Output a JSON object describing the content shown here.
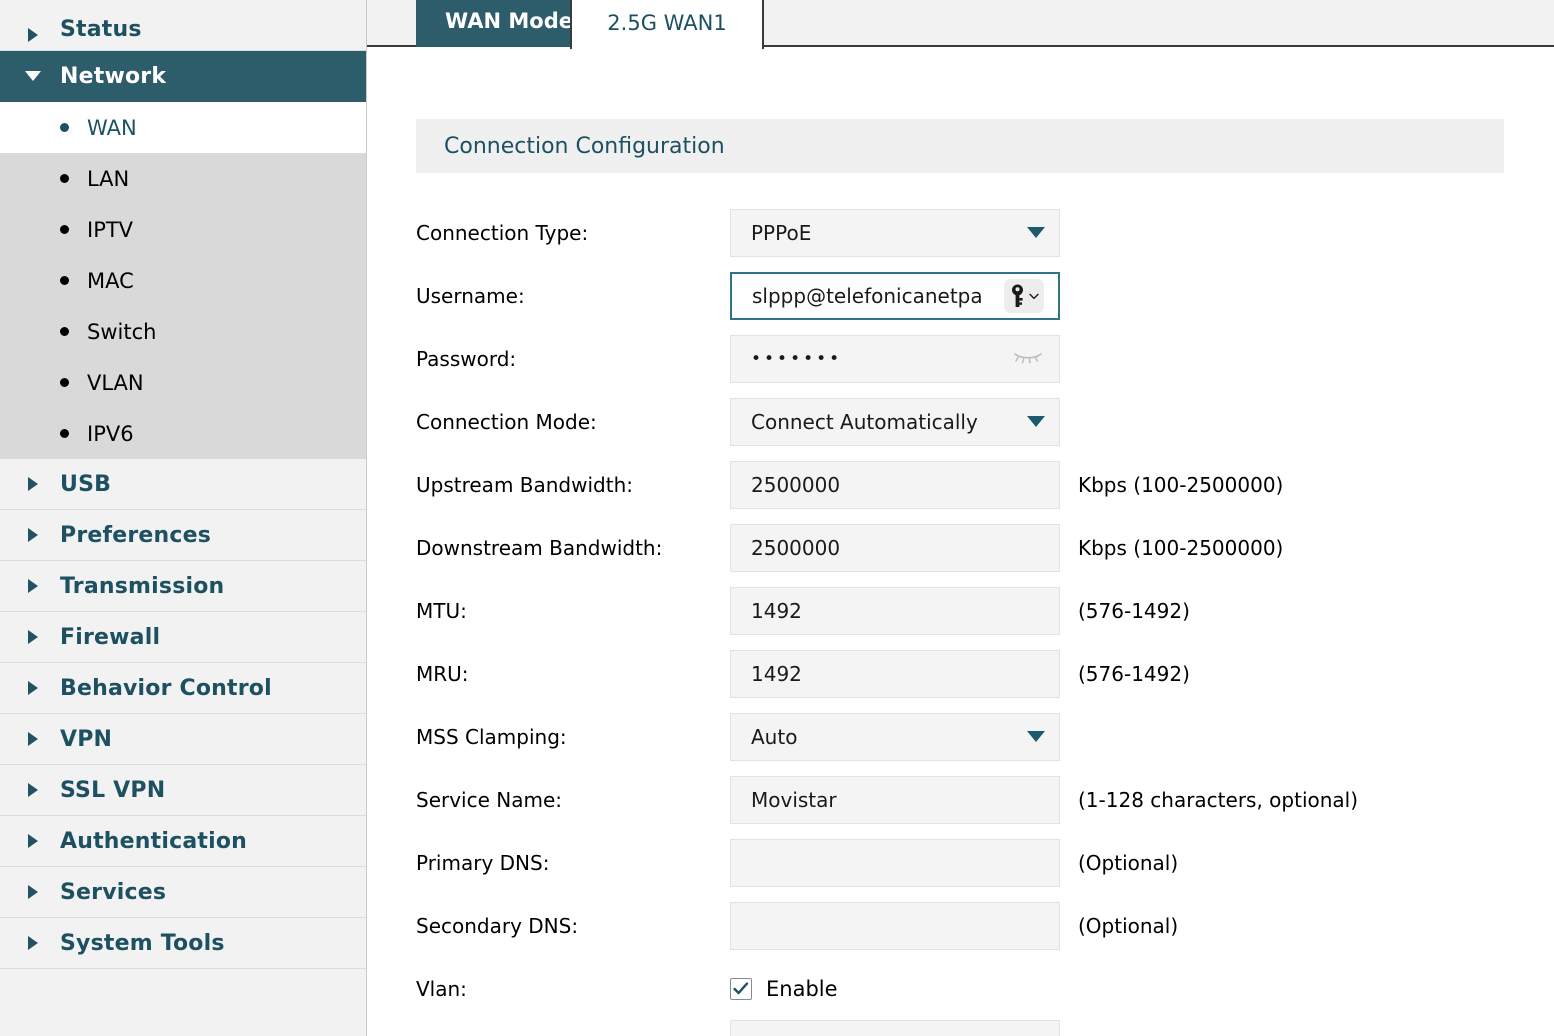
{
  "sidebar": {
    "groups": [
      {
        "label": "Status",
        "expanded": false,
        "icon": "chevron-right-icon"
      },
      {
        "label": "Network",
        "expanded": true,
        "icon": "chevron-down-icon",
        "children": [
          {
            "label": "WAN",
            "active": true
          },
          {
            "label": "LAN",
            "active": false
          },
          {
            "label": "IPTV",
            "active": false
          },
          {
            "label": "MAC",
            "active": false
          },
          {
            "label": "Switch",
            "active": false
          },
          {
            "label": "VLAN",
            "active": false
          },
          {
            "label": "IPV6",
            "active": false
          }
        ]
      },
      {
        "label": "USB",
        "expanded": false,
        "icon": "chevron-right-icon"
      },
      {
        "label": "Preferences",
        "expanded": false,
        "icon": "chevron-right-icon"
      },
      {
        "label": "Transmission",
        "expanded": false,
        "icon": "chevron-right-icon"
      },
      {
        "label": "Firewall",
        "expanded": false,
        "icon": "chevron-right-icon"
      },
      {
        "label": "Behavior Control",
        "expanded": false,
        "icon": "chevron-right-icon"
      },
      {
        "label": "VPN",
        "expanded": false,
        "icon": "chevron-right-icon"
      },
      {
        "label": "SSL VPN",
        "expanded": false,
        "icon": "chevron-right-icon"
      },
      {
        "label": "Authentication",
        "expanded": false,
        "icon": "chevron-right-icon"
      },
      {
        "label": "Services",
        "expanded": false,
        "icon": "chevron-right-icon"
      },
      {
        "label": "System Tools",
        "expanded": false,
        "icon": "chevron-right-icon"
      }
    ]
  },
  "tabs": [
    {
      "label": "WAN Mode",
      "active": false
    },
    {
      "label": "2.5G WAN1",
      "active": true
    }
  ],
  "panel": {
    "title": "Connection Configuration"
  },
  "form": {
    "connection_type": {
      "label": "Connection Type:",
      "value": "PPPoE",
      "control": "select"
    },
    "username": {
      "label": "Username:",
      "value": "slppp@telefonicanetpa",
      "control": "text",
      "focused": true,
      "icon": "key-icon"
    },
    "password": {
      "label": "Password:",
      "value": "•••••••",
      "control": "password",
      "icon": "eye-closed-icon"
    },
    "connection_mode": {
      "label": "Connection Mode:",
      "value": "Connect Automatically",
      "control": "select"
    },
    "upstream_bandwidth": {
      "label": "Upstream Bandwidth:",
      "value": "2500000",
      "hint": "Kbps (100-2500000)",
      "control": "text"
    },
    "downstream_bandwidth": {
      "label": "Downstream Bandwidth:",
      "value": "2500000",
      "hint": "Kbps (100-2500000)",
      "control": "text"
    },
    "mtu": {
      "label": "MTU:",
      "value": "1492",
      "hint": "(576-1492)",
      "control": "text"
    },
    "mru": {
      "label": "MRU:",
      "value": "1492",
      "hint": "(576-1492)",
      "control": "text"
    },
    "mss_clamping": {
      "label": "MSS Clamping:",
      "value": "Auto",
      "control": "select"
    },
    "service_name": {
      "label": "Service Name:",
      "value": "Movistar",
      "hint": "(1-128 characters, optional)",
      "control": "text"
    },
    "primary_dns": {
      "label": "Primary DNS:",
      "value": "",
      "hint": "(Optional)",
      "control": "text"
    },
    "secondary_dns": {
      "label": "Secondary DNS:",
      "value": "",
      "hint": "(Optional)",
      "control": "text"
    },
    "vlan": {
      "label": "Vlan:",
      "checkbox_label": "Enable",
      "checked": true
    }
  },
  "colors": {
    "accent_teal": "#1d5161",
    "nav_active_bg": "#2d5c6b",
    "submenu_bg": "#d9d9d9",
    "field_bg": "#f4f4f4",
    "focus_border": "#2d7488"
  }
}
